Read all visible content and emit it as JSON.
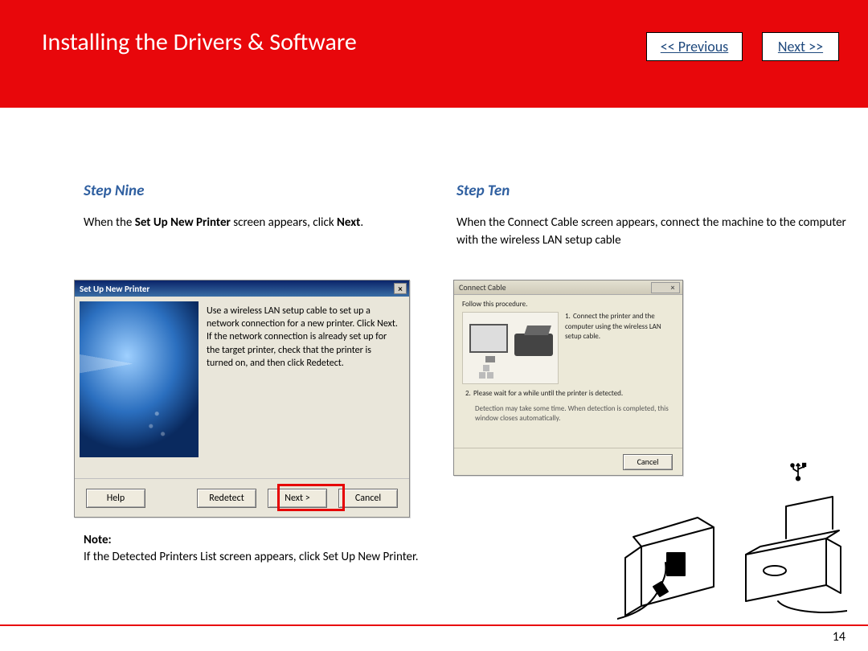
{
  "header": {
    "title": "Installing  the Drivers & Software",
    "prev": "<< Previous",
    "next": "Next >>"
  },
  "left": {
    "heading": "Step Nine",
    "text_pre": "When the ",
    "text_bold1": "Set Up New Printer",
    "text_mid": " screen appears, click ",
    "text_bold2": "Next",
    "text_post": "."
  },
  "dlg1": {
    "title": "Set Up New Printer",
    "body": "Use a wireless LAN setup cable to set up a network connection for a new printer. Click Next.\nIf the network connection is already set up for the target printer, check that the printer is turned on, and then click Redetect.",
    "btn_help": "Help",
    "btn_redetect": "Redetect",
    "btn_next": "Next >",
    "btn_cancel": "Cancel"
  },
  "note": {
    "label": "Note:",
    "text": "If the Detected Printers List screen appears, click Set Up New Printer."
  },
  "right": {
    "heading": "Step Ten",
    "text": "When the Connect Cable screen appears, connect the machine to the computer with the wireless LAN setup cable"
  },
  "dlg2": {
    "title": "Connect Cable",
    "lead": "Follow this procedure.",
    "item1": "Connect the printer and the computer using the wireless LAN setup cable.",
    "item2": "Please wait for a while until the printer is detected.",
    "item2b": "Detection may take some time. When detection is completed, this window closes automatically.",
    "btn_cancel": "Cancel"
  },
  "page_number": "14"
}
